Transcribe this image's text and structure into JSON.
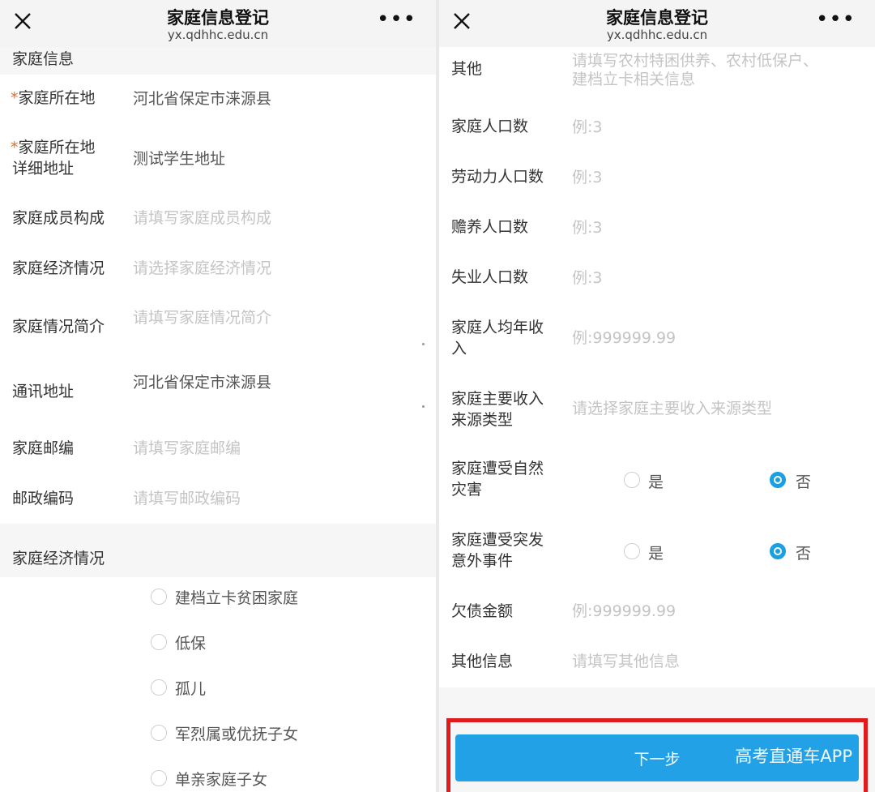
{
  "left": {
    "title": "家庭信息登记",
    "url": "yx.qdhhc.edu.cn",
    "section_family_info": "家庭信息",
    "fields": {
      "location_label": "家庭所在地",
      "location_value": "河北省保定市涞源县",
      "address_label_1": "家庭所在地",
      "address_label_2": "详细地址",
      "address_value": "测试学生地址",
      "members_label": "家庭成员构成",
      "members_placeholder": "请填写家庭成员构成",
      "economy_label": "家庭经济情况",
      "economy_placeholder": "请选择家庭经济情况",
      "intro_label": "家庭情况简介",
      "intro_placeholder": "请填写家庭情况简介",
      "mail_label": "通讯地址",
      "mail_value": "河北省保定市涞源县",
      "zip_label": "家庭邮编",
      "zip_placeholder": "请填写家庭邮编",
      "postal_label": "邮政编码",
      "postal_placeholder": "请填写邮政编码"
    },
    "section_economy": "家庭经济情况",
    "economy_options": [
      "建档立卡贫困家庭",
      "低保",
      "孤儿",
      "军烈属或优抚子女",
      "单亲家庭子女"
    ]
  },
  "right": {
    "title": "家庭信息登记",
    "url": "yx.qdhhc.edu.cn",
    "fields": {
      "other_label": "其他",
      "other_placeholder_1": "请填写农村特困供养、农村低保户、",
      "other_placeholder_2": "建档立卡相关信息",
      "population_label": "家庭人口数",
      "population_placeholder": "例:3",
      "labor_label": "劳动力人口数",
      "labor_placeholder": "例:3",
      "dependents_label": "赡养人口数",
      "dependents_placeholder": "例:3",
      "unemployed_label": "失业人口数",
      "unemployed_placeholder": "例:3",
      "income_label_1": "家庭人均年收",
      "income_label_2": "入",
      "income_placeholder": "例:999999.99",
      "income_source_label_1": "家庭主要收入",
      "income_source_label_2": "来源类型",
      "income_source_placeholder": "请选择家庭主要收入来源类型",
      "disaster_label_1": "家庭遭受自然",
      "disaster_label_2": "灾害",
      "accident_label_1": "家庭遭受突发",
      "accident_label_2": "意外事件",
      "yes": "是",
      "no": "否",
      "debt_label": "欠债金额",
      "debt_placeholder": "例:999999.99",
      "other_info_label": "其他信息",
      "other_info_placeholder": "请填写其他信息"
    },
    "disaster_selected": "否",
    "accident_selected": "否",
    "next_button": "下一步",
    "watermark": "高考直通车APP"
  },
  "colors": {
    "accent": "#22a1e6",
    "required": "#e0702a",
    "highlight_frame": "#e11b1b"
  }
}
